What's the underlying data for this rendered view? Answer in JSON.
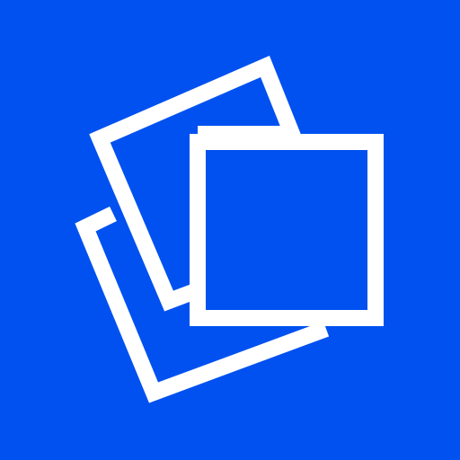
{
  "icon": {
    "name": "stacked-photos-icon",
    "background_color": "#0051f0",
    "foreground_color": "#ffffff"
  }
}
